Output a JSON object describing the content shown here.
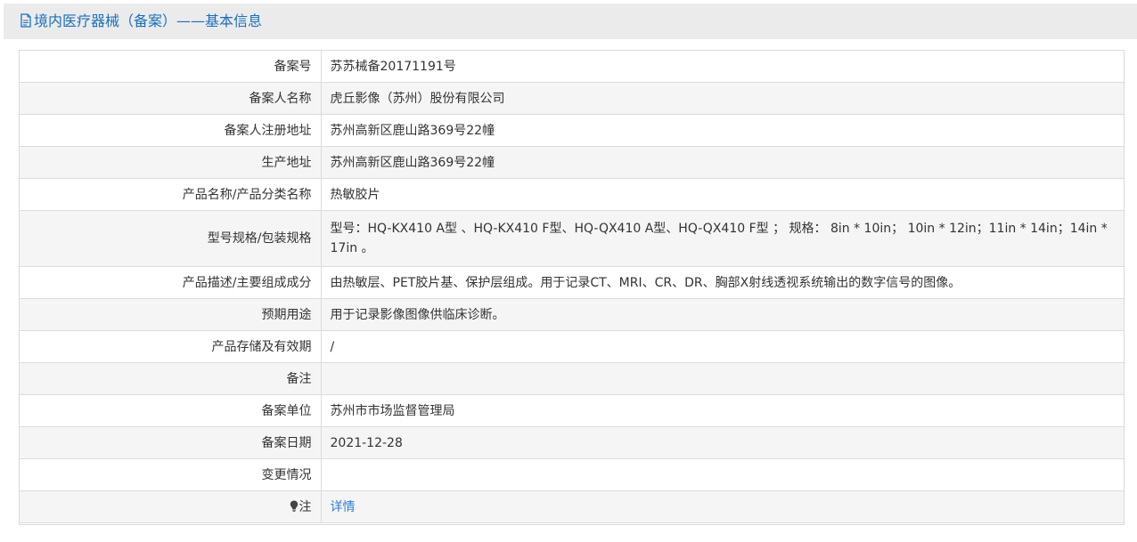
{
  "header": {
    "title": "境内医疗器械（备案）——基本信息",
    "icon": "document-icon",
    "title_color": "#1a6fbd"
  },
  "rows": [
    {
      "label": "备案号",
      "value": "苏苏械备20171191号"
    },
    {
      "label": "备案人名称",
      "value": "虎丘影像（苏州）股份有限公司"
    },
    {
      "label": "备案人注册地址",
      "value": "苏州高新区鹿山路369号22幢"
    },
    {
      "label": "生产地址",
      "value": "苏州高新区鹿山路369号22幢"
    },
    {
      "label": "产品名称/产品分类名称",
      "value": "热敏胶片"
    },
    {
      "label": "型号规格/包装规格",
      "value": "型号：HQ-KX410 A型 、HQ-KX410 F型、HQ-QX410 A型、HQ-QX410 F型 ； 规格： 8in * 10in； 10in * 12in；11in * 14in；14in * 17in 。"
    },
    {
      "label": "产品描述/主要组成成分",
      "value": "由热敏层、PET胶片基、保护层组成。用于记录CT、MRI、CR、DR、胸部X射线透视系统输出的数字信号的图像。"
    },
    {
      "label": "预期用途",
      "value": "用于记录影像图像供临床诊断。"
    },
    {
      "label": "产品存储及有效期",
      "value": "/"
    },
    {
      "label": "备注",
      "value": ""
    },
    {
      "label": "备案单位",
      "value": "苏州市市场监督管理局"
    },
    {
      "label": "备案日期",
      "value": "2021-12-28"
    },
    {
      "label": "变更情况",
      "value": ""
    }
  ],
  "note_row": {
    "label": "注",
    "icon": "lightbulb-icon",
    "link_text": "详情",
    "link_color": "#2f7fd1"
  }
}
